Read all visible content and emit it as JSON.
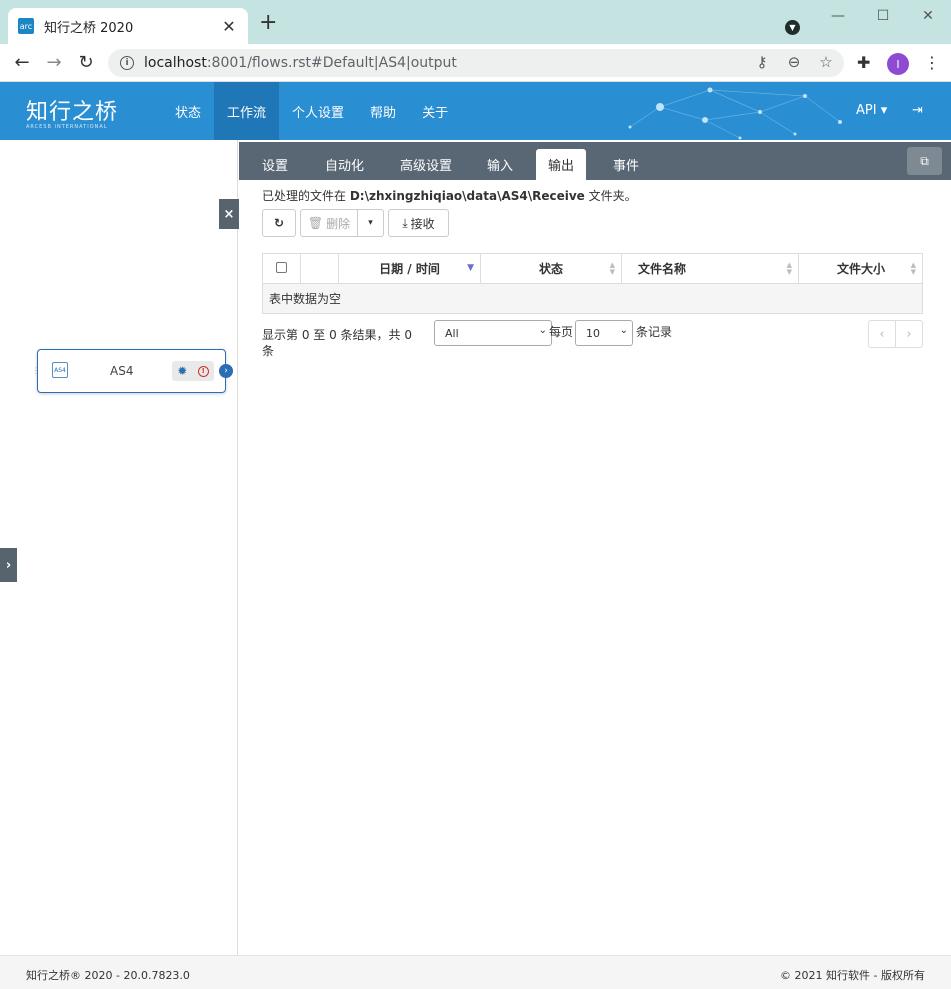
{
  "browser": {
    "tab_title": "知行之桥 2020",
    "tab_favicon_text": "arc",
    "tab_close": "✕",
    "new_tab": "+",
    "url_host": "localhost",
    "url_rest": ":8001/flows.rst#Default|AS4|output",
    "profile_initial": "I"
  },
  "header": {
    "logo_text": "知行之桥",
    "logo_sub": "ARCESB INTERNATIONAL",
    "nav": [
      "状态",
      "工作流",
      "个人设置",
      "帮助",
      "关于"
    ],
    "api_label": "API ▾",
    "logout_icon": "logout-icon"
  },
  "flow": {
    "node_name": "AS4",
    "node_icon_text": "AS4"
  },
  "panel": {
    "tabs": [
      "设置",
      "自动化",
      "高级设置",
      "输入",
      "输出",
      "事件"
    ],
    "active_tab": "输出",
    "desc_prefix": "已处理的文件在 ",
    "desc_path": "D:\\zhxingzhiqiao\\data\\AS4\\Receive",
    "desc_suffix": " 文件夹。",
    "delete_label": "删除",
    "receive_label": "接收"
  },
  "table": {
    "columns": [
      "",
      "",
      "日期 / 时间",
      "状态",
      "文件名称",
      "文件大小"
    ],
    "empty_text": "表中数据为空"
  },
  "paging": {
    "info": "显示第 0 至 0 条结果，共 0 条",
    "filter_value": "All",
    "per_page_label": "每页",
    "page_size": "10",
    "records_label": "条记录",
    "prev": "‹",
    "next": "›"
  },
  "footer": {
    "left": "知行之桥® 2020 - 20.0.7823.0",
    "right": "© 2021 知行软件 - 版权所有"
  },
  "colors": {
    "header_bg": "#2a8ed2",
    "tabstrip_bg": "#586773",
    "browser_tabbar": "#c4e3e1"
  }
}
